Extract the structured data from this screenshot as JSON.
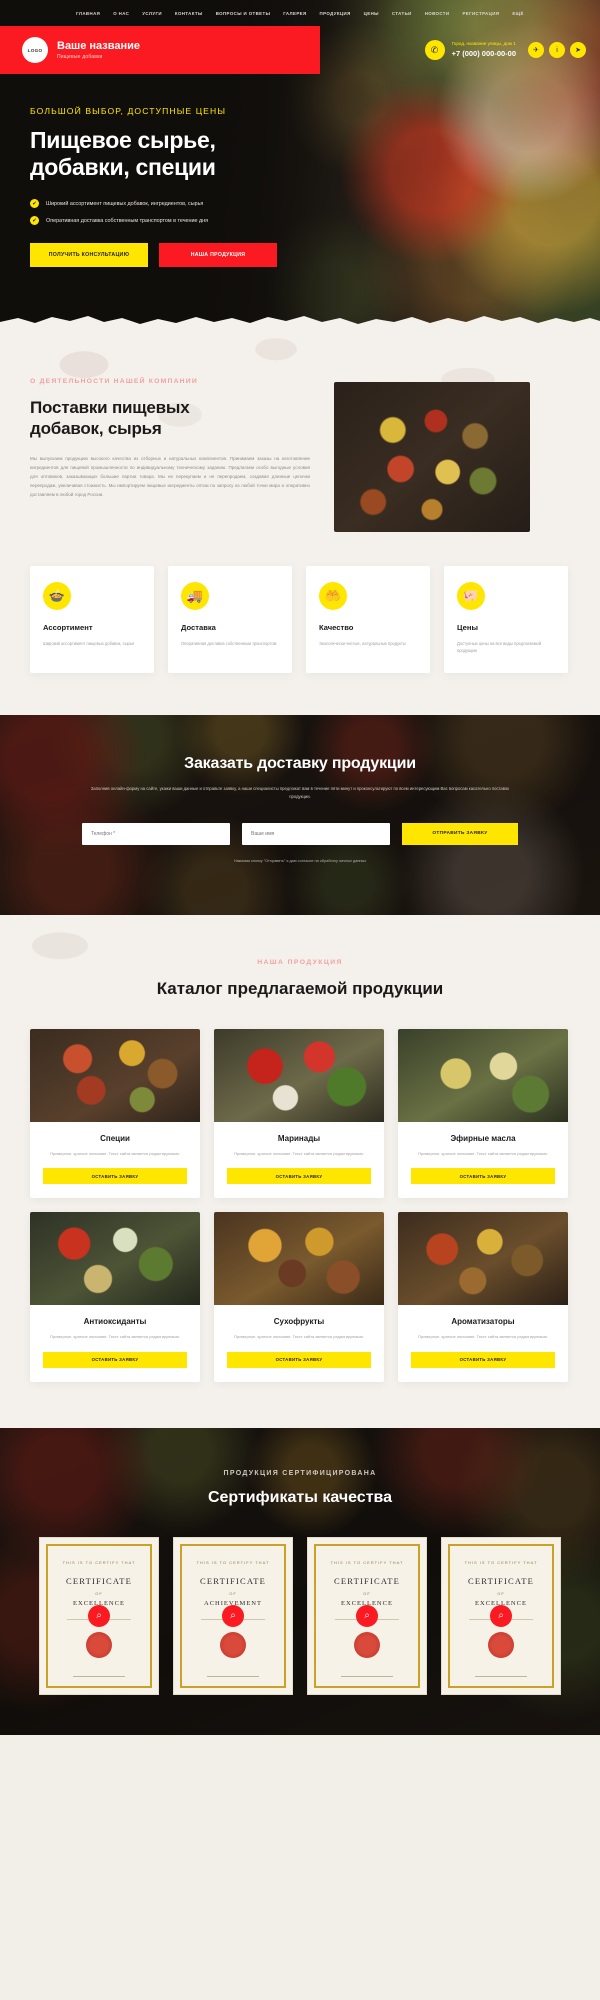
{
  "nav": {
    "items": [
      {
        "label": "ГЛАВНАЯ"
      },
      {
        "label": "О НАС"
      },
      {
        "label": "УСЛУГИ"
      },
      {
        "label": "КОНТАКТЫ"
      },
      {
        "label": "ВОПРОСЫ И ОТВЕТЫ"
      },
      {
        "label": "ГАЛЕРЕЯ"
      },
      {
        "label": "ПРОДУКЦИЯ"
      },
      {
        "label": "ЦЕНЫ"
      },
      {
        "label": "СТАТЬИ"
      },
      {
        "label": "НОВОСТИ"
      },
      {
        "label": "РЕГИСТРАЦИЯ"
      },
      {
        "label": "ЕЩЁ"
      }
    ]
  },
  "header": {
    "logo_text": "LOGO",
    "brand_name": "Ваше название",
    "brand_sub": "Пищевые добавки",
    "phone_icon": "phone-icon",
    "address": "Город, название улицы, дом 1",
    "phone": "+7 (000) 000-00-00",
    "social": [
      {
        "icon": "messenger-icon",
        "glyph": "✈"
      },
      {
        "icon": "info-icon",
        "glyph": "i"
      },
      {
        "icon": "telegram-icon",
        "glyph": "➤"
      }
    ],
    "accent_red": "#fb1a21",
    "accent_yellow": "#ffe600"
  },
  "hero": {
    "kicker": "БОЛЬШОЙ ВЫБОР, ДОСТУПНЫЕ ЦЕНЫ",
    "title_line1": "Пищевое сырье,",
    "title_line2": "добавки, специи",
    "bullets": [
      "Широкий ассортимент пищевых добавок, ингредиентов, сырья",
      "Оперативная доставка собственным транспортом в течение дня"
    ],
    "btn_primary": "ПОЛУЧИТЬ КОНСУЛЬТАЦИЮ",
    "btn_secondary": "НАША ПРОДУКЦИЯ"
  },
  "about": {
    "kicker": "О ДЕЯТЕЛЬНОСТИ НАШЕЙ КОМПАНИИ",
    "title_line1": "Поставки пищевых",
    "title_line2": "добавок, сырья",
    "paragraph": "Мы выпускаем продукцию высокого качества из отборных и натуральных компонентов. Принимаем заказы на изготовление ингредиентов для пищевой промышленности по индивидуальному техническому заданию. Предлагаем особо выгодные условия для оптовиков, заказывающих большие партии товара. Мы не перекупаем и не перепродаем, создавая длинные цепочки перепродаж, увеличивая стоимость. Мы импортируем пищевые ингредиенты оптом по запросу из любой точки мира и оперативно доставляем в любой город России.",
    "features": [
      {
        "icon": "spices-bowl-icon",
        "glyph": "🍲",
        "title": "Ассортимент",
        "text": "Широкий ассортимент пищевых добавок, сырья"
      },
      {
        "icon": "delivery-truck-icon",
        "glyph": "🚚",
        "title": "Доставка",
        "text": "Оперативная доставка собственным транспортом"
      },
      {
        "icon": "quality-hands-icon",
        "glyph": "🤲",
        "title": "Качество",
        "text": "Экологически чистые, натуральные продукты"
      },
      {
        "icon": "piggy-bank-icon",
        "glyph": "🐖",
        "title": "Цены",
        "text": "Доступные цены на все виды предлагаемой продукции"
      }
    ]
  },
  "order": {
    "title": "Заказать доставку продукции",
    "subtitle": "Заполнив онлайн-форму на сайте, укажи ваши данные и отправьте заявку, а наши специалисты предложат вам в течение пяти минут и проконсультируют по всем интересующим Вас вопросам касательно поставок продукции.",
    "fields": [
      {
        "name": "phone-field",
        "placeholder": "Телефон *",
        "value": ""
      },
      {
        "name": "name-field",
        "placeholder": "Ваше имя",
        "value": ""
      }
    ],
    "submit": "ОТПРАВИТЬ ЗАЯВКУ",
    "note": "Нажимая кнопку \"Отправить\" я даю согласие на обработку личных данных"
  },
  "catalog": {
    "kicker": "НАША ПРОДУКЦИЯ",
    "title": "Каталог предлагаемой продукции",
    "card_desc": "Примерное, краткое описание. Текст сайта является редактируемым.",
    "card_button": "ОСТАВИТЬ ЗАЯВКУ",
    "products": [
      {
        "name": "Специи",
        "image": "spices-photo"
      },
      {
        "name": "Маринады",
        "image": "marinades-photo"
      },
      {
        "name": "Эфирные масла",
        "image": "essential-oils-photo"
      },
      {
        "name": "Антиоксиданты",
        "image": "antioxidants-photo"
      },
      {
        "name": "Сухофрукты",
        "image": "dried-fruits-photo"
      },
      {
        "name": "Ароматизаторы",
        "image": "flavourings-photo"
      }
    ]
  },
  "certificates": {
    "kicker": "ПРОДУКЦИЯ СЕРТИФИЦИРОВАНА",
    "title": "Сертификаты качества",
    "items": [
      {
        "top": "THIS IS TO CERTIFY THAT",
        "head": "CERTIFICATE",
        "of": "OF",
        "head2": "EXCELLENCE",
        "zoom_icon": "zoom-in-icon"
      },
      {
        "top": "THIS IS TO CERTIFY THAT",
        "head": "CERTIFICATE",
        "of": "OF",
        "head2": "ACHIEVEMENT",
        "zoom_icon": "zoom-in-icon"
      },
      {
        "top": "THIS IS TO CERTIFY THAT",
        "head": "CERTIFICATE",
        "of": "OF",
        "head2": "EXCELLENCE",
        "zoom_icon": "zoom-in-icon"
      },
      {
        "top": "THIS IS TO CERTIFY THAT",
        "head": "CERTIFICATE",
        "of": "OF",
        "head2": "EXCELLENCE",
        "zoom_icon": "zoom-in-icon"
      }
    ]
  }
}
